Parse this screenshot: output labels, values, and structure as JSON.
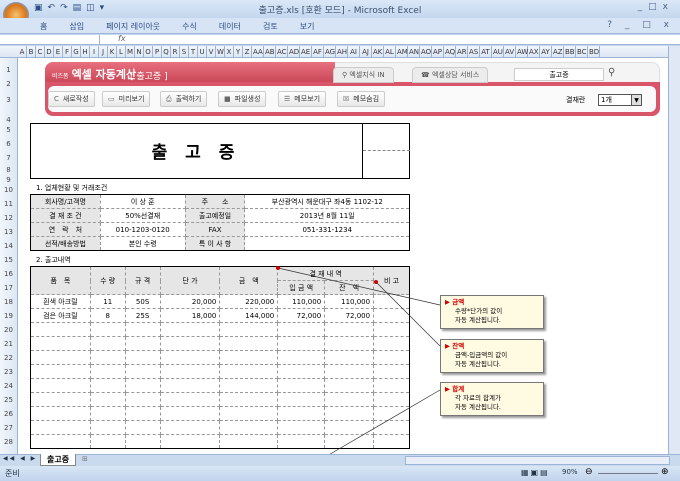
{
  "window": {
    "title": "출고증.xls [호환 모드] - Microsoft Excel",
    "controls": [
      "_",
      "□",
      "x"
    ]
  },
  "ribbon": {
    "tabs": [
      "홈",
      "삽입",
      "페이지 레이아웃",
      "수식",
      "데이터",
      "검토",
      "보기"
    ]
  },
  "formula_bar": {
    "name_box": "",
    "fx": "fx"
  },
  "columns": [
    "A",
    "B",
    "C",
    "D",
    "E",
    "F",
    "G",
    "H",
    "I",
    "J",
    "K",
    "L",
    "M",
    "N",
    "O",
    "P",
    "Q",
    "R",
    "S",
    "T",
    "U",
    "V",
    "W",
    "X",
    "Y",
    "Z",
    "AA",
    "AB",
    "AC",
    "AD",
    "AE",
    "AF",
    "AG",
    "AH",
    "AI",
    "AJ",
    "AK",
    "AL",
    "AM",
    "AN",
    "AO",
    "AP",
    "AQ",
    "AR",
    "AS",
    "AT",
    "AU",
    "AV",
    "AW",
    "AX",
    "AY",
    "AZ",
    "BB",
    "BC",
    "BD"
  ],
  "rows": [
    "1",
    "2",
    "3",
    "4",
    "5",
    "6",
    "7",
    "8",
    "9",
    "10",
    "11",
    "12",
    "13",
    "14",
    "15",
    "16",
    "17",
    "18",
    "19",
    "20",
    "21",
    "22",
    "23",
    "24",
    "25",
    "26",
    "27",
    "28"
  ],
  "banner": {
    "brand_small": "비즈폼",
    "brand": "엑셀 자동계산",
    "doc_type": "[ 출고증 ]",
    "link1": "엑셀지식 IN",
    "link2": "엑셀상담 서비스",
    "search_value": "출고증"
  },
  "toolbar": {
    "buttons": [
      "새로작성",
      "미리보기",
      "출력하기",
      "파일생성",
      "메모보기",
      "메모숨김"
    ],
    "approval_label": "결재란",
    "approval_value": "1개"
  },
  "form": {
    "title": "출 고 증",
    "section1": "1. 업체현황 및 거래조건",
    "info": [
      [
        "회사명/고객명",
        "이 상 훈",
        "주　　소",
        "부산광역시 해운대구 좌4동 1102-12"
      ],
      [
        "결 재 조 건",
        "50%선결재",
        "출고예정일",
        "2013년 8월 11일"
      ],
      [
        "연　락　처",
        "010-1203-0120",
        "FAX",
        "051-331-1234"
      ],
      [
        "선적/배송방법",
        "본인 수령",
        "특 이 사 항",
        ""
      ]
    ],
    "section2": "2. 출고내역",
    "headers": {
      "item": "품　목",
      "qty": "수 량",
      "spec": "규 격",
      "price": "단 가",
      "amount": "금　액",
      "payment": "결 재 내 역",
      "paid": "입 금 액",
      "balance": "잔　액",
      "note": "비 고"
    },
    "items": [
      [
        "흰색 아크릴",
        "11",
        "50S",
        "20,000",
        "220,000",
        "110,000",
        "110,000",
        ""
      ],
      [
        "검은 아크릴",
        "8",
        "25S",
        "18,000",
        "144,000",
        "72,000",
        "72,000",
        ""
      ]
    ]
  },
  "callouts": [
    {
      "title": "금액",
      "lines": [
        "수량*단가의 값이",
        "자동 계산됩니다."
      ]
    },
    {
      "title": "잔액",
      "lines": [
        "금액-입금액의 값이",
        "자동 계산됩니다."
      ]
    },
    {
      "title": "합계",
      "lines": [
        "각 자료의 합계가",
        "자동 계산됩니다."
      ]
    }
  ],
  "sheet_tabs": [
    "출고증"
  ],
  "status": {
    "ready": "준비",
    "zoom": "90%"
  }
}
